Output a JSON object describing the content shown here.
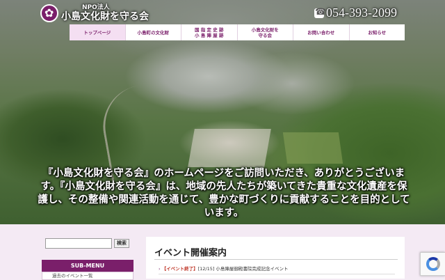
{
  "site": {
    "org_prefix": "NPO法人",
    "name": "小島文化財を守る会",
    "phone": "054-393-2099"
  },
  "nav": [
    {
      "label": "トップページ",
      "active": true
    },
    {
      "label": "小島町の文化財",
      "active": false
    },
    {
      "label": "国 指 定 史 跡\n小 島 陣 屋 跡",
      "active": false
    },
    {
      "label": "小島文化財を\n守る会",
      "active": false
    },
    {
      "label": "お問い合わせ",
      "active": false
    },
    {
      "label": "お知らせ",
      "active": false
    }
  ],
  "hero": {
    "message": "『小島文化財を守る会』のホームページをご訪問いただき、ありがとうございます。『小島文化財を守る会』は、地域の先人たちが築いてきた貴重な文化遺産を保護し、その整備や関連活動を通じて、豊かな町づくりに貢献することを目的としています。"
  },
  "sidebar": {
    "search_placeholder": "",
    "search_button": "検索",
    "submenu_title": "SUB-MENU",
    "submenu_first_item": "過去のイベント一覧"
  },
  "main": {
    "section_title": "イベント開催案内",
    "events": [
      {
        "status": "【イベント終了】",
        "date": "[12/15]",
        "title": "小島陣屋御殿書院完成記念イベント"
      }
    ]
  },
  "colors": {
    "brand": "#7a1f6a",
    "nav_active_bg": "#f4dff2",
    "page_bg": "#f4eaf4"
  },
  "icons": {
    "logo": "flower-crest-icon",
    "phone": "phone-icon",
    "recaptcha": "recaptcha-icon"
  }
}
